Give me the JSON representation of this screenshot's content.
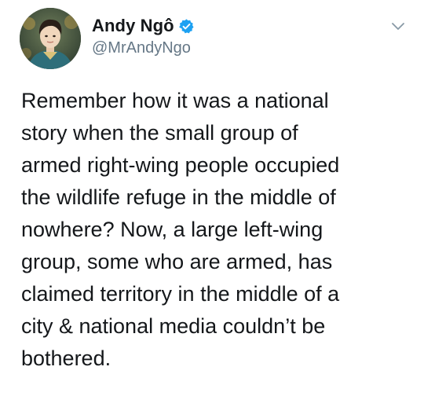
{
  "author": {
    "display_name": "Andy Ngô",
    "handle": "@MrAndyNgo",
    "verified": true,
    "verified_color": "#1da1f2"
  },
  "icons": {
    "verified": "verified-badge-icon",
    "menu": "chevron-down-icon"
  },
  "tweet": {
    "lines": [
      "Remember how it was a national",
      "story when the small group of",
      "armed right-wing people occupied",
      "the wildlife refuge in the middle of",
      "nowhere? Now, a large left-wing",
      "group, some who are armed, has",
      "claimed territory in the middle of a",
      "city & national media couldn’t be",
      "bothered."
    ]
  },
  "colors": {
    "text": "#14171a",
    "secondary_text": "#657786",
    "chevron": "#8899a6"
  }
}
